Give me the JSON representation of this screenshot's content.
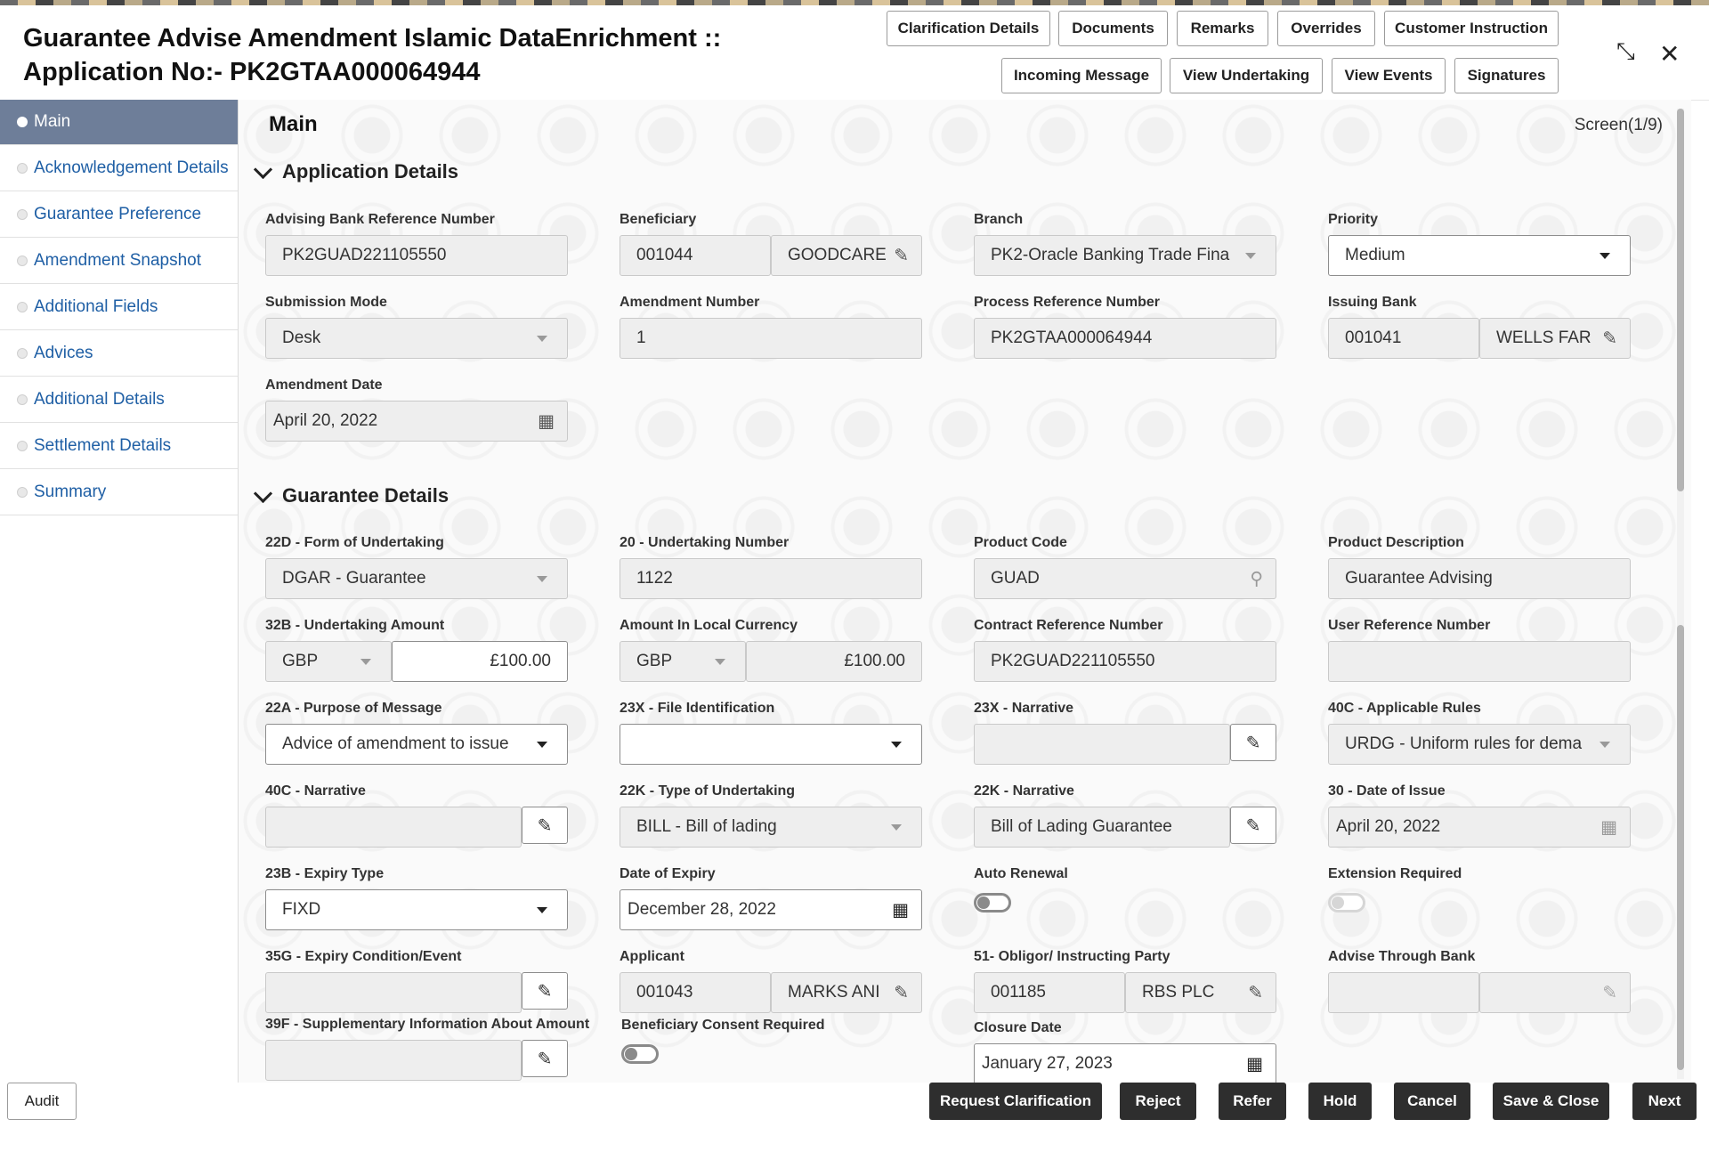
{
  "header": {
    "title_line1": "Guarantee Advise Amendment Islamic DataEnrichment ::",
    "title_line2": "Application No:- PK2GTAA000064944",
    "buttons_row1": [
      "Clarification Details",
      "Documents",
      "Remarks",
      "Overrides",
      "Customer Instruction"
    ],
    "buttons_row2": [
      "Incoming Message",
      "View Undertaking",
      "View Events",
      "Signatures"
    ]
  },
  "sidebar": {
    "items": [
      "Main",
      "Acknowledgement Details",
      "Guarantee Preference",
      "Amendment Snapshot",
      "Additional Fields",
      "Advices",
      "Additional Details",
      "Settlement Details",
      "Summary"
    ]
  },
  "main": {
    "title": "Main",
    "screen": "Screen(1/9)",
    "section1": "Application Details",
    "section2": "Guarantee Details"
  },
  "app": {
    "advising_bank_ref": {
      "label": "Advising Bank Reference Number",
      "value": "PK2GUAD221105550"
    },
    "beneficiary": {
      "label": "Beneficiary",
      "code": "001044",
      "name": "GOODCARE"
    },
    "branch": {
      "label": "Branch",
      "value": "PK2-Oracle Banking Trade Fina"
    },
    "priority": {
      "label": "Priority",
      "value": "Medium"
    },
    "submission_mode": {
      "label": "Submission Mode",
      "value": "Desk"
    },
    "amendment_number": {
      "label": "Amendment Number",
      "value": "1"
    },
    "process_ref": {
      "label": "Process Reference Number",
      "value": "PK2GTAA000064944"
    },
    "issuing_bank": {
      "label": "Issuing Bank",
      "code": "001041",
      "name": "WELLS FAR"
    },
    "amendment_date": {
      "label": "Amendment Date",
      "value": "April 20, 2022"
    }
  },
  "guar": {
    "form": {
      "label": "22D - Form of Undertaking",
      "value": "DGAR - Guarantee"
    },
    "undertaking_number": {
      "label": "20 - Undertaking Number",
      "value": "1122"
    },
    "product_code": {
      "label": "Product Code",
      "value": "GUAD"
    },
    "product_desc": {
      "label": "Product Description",
      "value": "Guarantee Advising"
    },
    "amount": {
      "label": "32B - Undertaking Amount",
      "ccy": "GBP",
      "value": "£100.00"
    },
    "local_amount": {
      "label": "Amount In Local Currency",
      "ccy": "GBP",
      "value": "£100.00"
    },
    "contract_ref": {
      "label": "Contract Reference Number",
      "value": "PK2GUAD221105550"
    },
    "user_ref": {
      "label": "User Reference Number",
      "value": ""
    },
    "purpose": {
      "label": "22A - Purpose of Message",
      "value": "Advice of amendment to issue"
    },
    "file_id": {
      "label": "23X - File Identification",
      "value": ""
    },
    "narrative_23x": {
      "label": "23X - Narrative",
      "value": ""
    },
    "rules": {
      "label": "40C - Applicable Rules",
      "value": "URDG - Uniform rules for dema"
    },
    "narrative_40c": {
      "label": "40C - Narrative",
      "value": ""
    },
    "type": {
      "label": "22K - Type of Undertaking",
      "value": "BILL - Bill of lading"
    },
    "narrative_22k": {
      "label": "22K - Narrative",
      "value": "Bill of Lading Guarantee"
    },
    "date_issue": {
      "label": "30 - Date of Issue",
      "value": "April 20, 2022"
    },
    "expiry_type": {
      "label": "23B - Expiry Type",
      "value": "FIXD"
    },
    "date_expiry": {
      "label": "Date of Expiry",
      "value": "December 28, 2022"
    },
    "auto_renewal": {
      "label": "Auto Renewal"
    },
    "extension": {
      "label": "Extension Required"
    },
    "expiry_cond": {
      "label": "35G - Expiry Condition/Event",
      "value": ""
    },
    "applicant": {
      "label": "Applicant",
      "code": "001043",
      "name": "MARKS ANI"
    },
    "obligor": {
      "label": "51- Obligor/ Instructing Party",
      "code": "001185",
      "name": "RBS PLC"
    },
    "advise_bank": {
      "label": "Advise Through Bank",
      "code": "",
      "name": ""
    },
    "supp_info": {
      "label": "39F - Supplementary Information About Amount",
      "value": ""
    },
    "consent": {
      "label": "Beneficiary Consent Required"
    },
    "closure_date": {
      "label": "Closure Date",
      "value": "January 27, 2023"
    }
  },
  "footer": {
    "audit": "Audit",
    "buttons": [
      "Request Clarification",
      "Reject",
      "Refer",
      "Hold",
      "Cancel",
      "Save & Close",
      "Next"
    ]
  }
}
